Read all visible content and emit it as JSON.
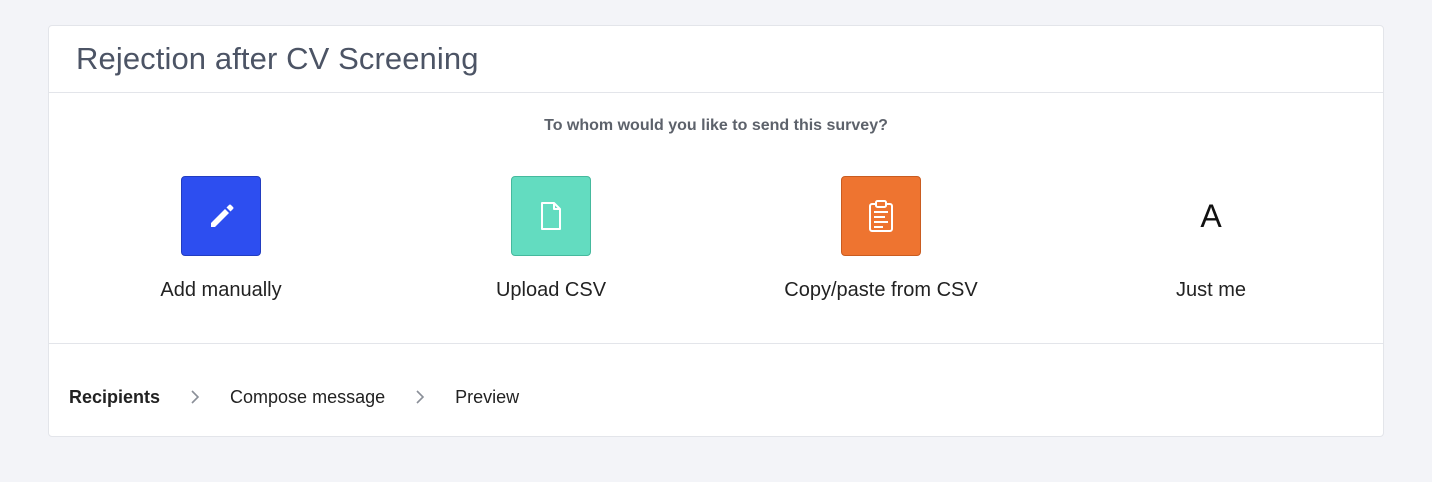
{
  "header": {
    "title": "Rejection after CV Screening"
  },
  "survey": {
    "question": "To whom would you like to send this survey?",
    "options": [
      {
        "label": "Add manually",
        "icon": "pencil-icon",
        "color": "#2d4ef0"
      },
      {
        "label": "Upload CSV",
        "icon": "file-icon",
        "color": "#63dcc0"
      },
      {
        "label": "Copy/paste from CSV",
        "icon": "clipboard-icon",
        "color": "#ee7430"
      },
      {
        "label": "Just me",
        "avatar_initial": "A"
      }
    ]
  },
  "steps": {
    "items": [
      {
        "label": "Recipients",
        "active": true
      },
      {
        "label": "Compose message",
        "active": false
      },
      {
        "label": "Preview",
        "active": false
      }
    ]
  }
}
